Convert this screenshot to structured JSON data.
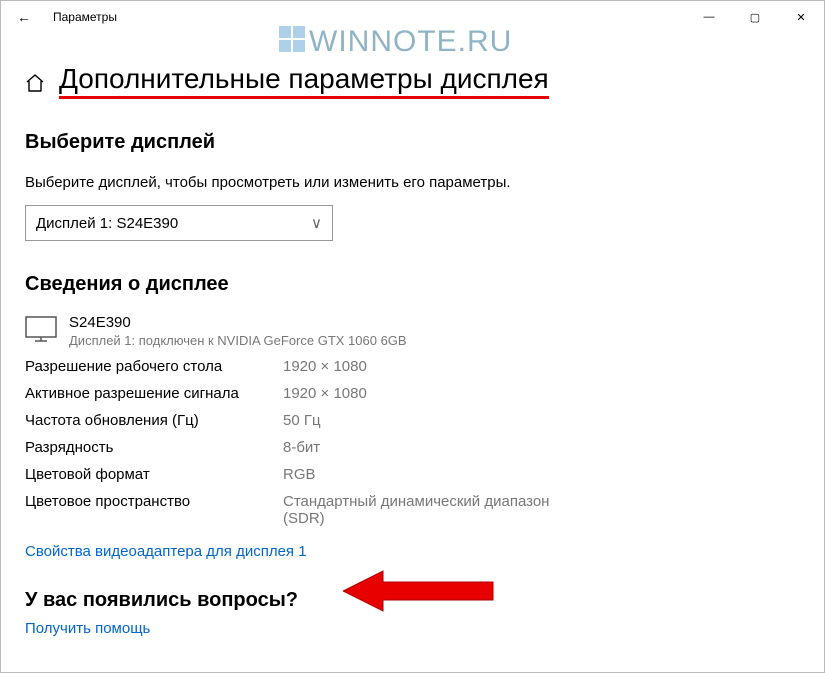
{
  "titlebar": {
    "back_glyph": "←",
    "title": "Параметры",
    "min": "—",
    "max": "▢",
    "close": "✕"
  },
  "watermark": "WINNOTE.RU",
  "page_title": "Дополнительные параметры дисплея",
  "choose_heading": "Выберите дисплей",
  "choose_prompt": "Выберите дисплей, чтобы просмотреть или изменить его параметры.",
  "display_select": "Дисплей 1: S24E390",
  "info_heading": "Сведения о дисплее",
  "display": {
    "name": "S24E390",
    "connection": "Дисплей 1: подключен к NVIDIA GeForce GTX 1060 6GB"
  },
  "specs": [
    {
      "label": "Разрешение рабочего стола",
      "value": "1920 × 1080"
    },
    {
      "label": "Активное разрешение сигнала",
      "value": "1920 × 1080"
    },
    {
      "label": "Частота обновления (Гц)",
      "value": "50 Гц"
    },
    {
      "label": "Разрядность",
      "value": "8-бит"
    },
    {
      "label": "Цветовой формат",
      "value": "RGB"
    },
    {
      "label": "Цветовое пространство",
      "value": "Стандартный динамический диапазон (SDR)"
    }
  ],
  "adapter_link": "Свойства видеоадаптера для дисплея 1",
  "questions_heading": "У вас появились вопросы?",
  "help_link": "Получить помощь"
}
